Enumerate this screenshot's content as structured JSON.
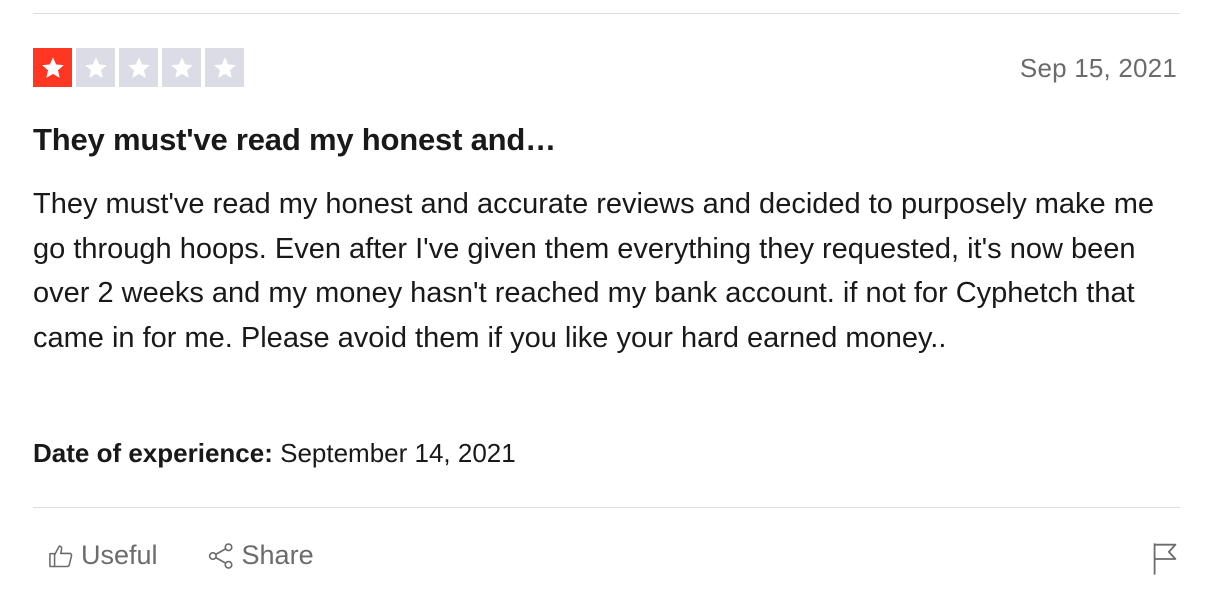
{
  "review": {
    "rating": 1,
    "max_rating": 5,
    "date": "Sep 15, 2021",
    "title": "They must've read my honest and…",
    "body": "They must've read my honest and accurate reviews and decided to purposely make me go through hoops. Even after I've given them everything they requested, it's now been over 2 weeks and my money hasn't reached my bank account. if not for Cyphetch that came in for me. Please avoid them if you like your hard earned money..",
    "experience_label": "Date of experience:",
    "experience_date": "September 14, 2021"
  },
  "actions": {
    "useful_label": "Useful",
    "share_label": "Share"
  },
  "colors": {
    "star_filled": "#ff3722",
    "star_empty": "#dcdce6",
    "text": "#191919",
    "muted": "#6b6b6b"
  },
  "icons": {
    "star": "star-icon",
    "useful": "thumbs-up-icon",
    "share": "share-icon",
    "report": "flag-icon"
  }
}
